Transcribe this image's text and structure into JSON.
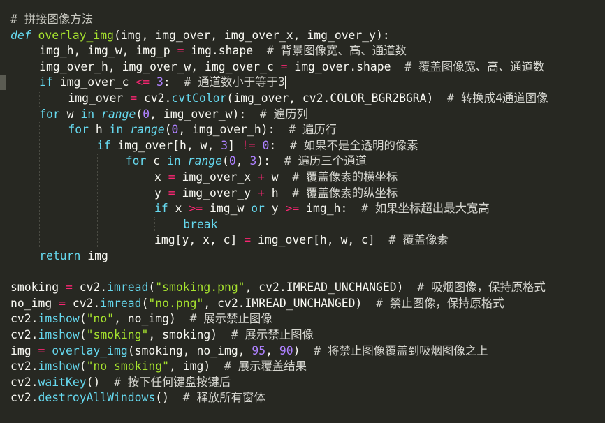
{
  "editor": {
    "lines": [
      {
        "indent": 0,
        "tokens": [
          {
            "t": "# 拼接图像方法",
            "c": "cm-head"
          }
        ]
      },
      {
        "indent": 0,
        "tokens": [
          {
            "t": "def",
            "c": "def"
          },
          {
            "t": " "
          },
          {
            "t": "overlay_img",
            "c": "fn"
          },
          {
            "t": "(img, img_over, img_over_x, img_over_y):"
          }
        ]
      },
      {
        "indent": 1,
        "tokens": [
          {
            "t": "img_h, img_w, img_p "
          },
          {
            "t": "=",
            "c": "op"
          },
          {
            "t": " img.shape  "
          },
          {
            "t": "# 背景图像宽、高、通道数",
            "c": "cm"
          }
        ]
      },
      {
        "indent": 1,
        "tokens": [
          {
            "t": "img_over_h, img_over_w, img_over_c "
          },
          {
            "t": "=",
            "c": "op"
          },
          {
            "t": " img_over.shape  "
          },
          {
            "t": "# 覆盖图像宽、高、通道数",
            "c": "cm"
          }
        ]
      },
      {
        "indent": 1,
        "marker": true,
        "tokens": [
          {
            "t": "if",
            "c": "kw"
          },
          {
            "t": " img_over_c "
          },
          {
            "t": "<=",
            "c": "op"
          },
          {
            "t": " "
          },
          {
            "t": "3",
            "c": "num"
          },
          {
            "t": ":  "
          },
          {
            "t": "# 通道数小于等于3",
            "c": "cm"
          },
          {
            "cursor": true
          }
        ]
      },
      {
        "indent": 2,
        "tokens": [
          {
            "t": "img_over "
          },
          {
            "t": "=",
            "c": "op"
          },
          {
            "t": " cv2."
          },
          {
            "t": "cvtColor",
            "c": "kw"
          },
          {
            "t": "(img_over, cv2.COLOR_BGR2BGRA)  "
          },
          {
            "t": "# 转换成4通道图像",
            "c": "cm"
          }
        ]
      },
      {
        "indent": 1,
        "tokens": [
          {
            "t": "for",
            "c": "kw"
          },
          {
            "t": " w "
          },
          {
            "t": "in",
            "c": "kw"
          },
          {
            "t": " "
          },
          {
            "t": "range",
            "c": "bi"
          },
          {
            "t": "("
          },
          {
            "t": "0",
            "c": "num"
          },
          {
            "t": ", img_over_w):  "
          },
          {
            "t": "# 遍历列",
            "c": "cm"
          }
        ]
      },
      {
        "indent": 2,
        "tokens": [
          {
            "t": "for",
            "c": "kw"
          },
          {
            "t": " h "
          },
          {
            "t": "in",
            "c": "kw"
          },
          {
            "t": " "
          },
          {
            "t": "range",
            "c": "bi"
          },
          {
            "t": "("
          },
          {
            "t": "0",
            "c": "num"
          },
          {
            "t": ", img_over_h):  "
          },
          {
            "t": "# 遍历行",
            "c": "cm"
          }
        ]
      },
      {
        "indent": 3,
        "tokens": [
          {
            "t": "if",
            "c": "kw"
          },
          {
            "t": " img_over[h, w, "
          },
          {
            "t": "3",
            "c": "num"
          },
          {
            "t": "] "
          },
          {
            "t": "!=",
            "c": "op"
          },
          {
            "t": " "
          },
          {
            "t": "0",
            "c": "num"
          },
          {
            "t": ":  "
          },
          {
            "t": "# 如果不是全透明的像素",
            "c": "cm"
          }
        ]
      },
      {
        "indent": 4,
        "tokens": [
          {
            "t": "for",
            "c": "kw"
          },
          {
            "t": " c "
          },
          {
            "t": "in",
            "c": "kw"
          },
          {
            "t": " "
          },
          {
            "t": "range",
            "c": "bi"
          },
          {
            "t": "("
          },
          {
            "t": "0",
            "c": "num"
          },
          {
            "t": ", "
          },
          {
            "t": "3",
            "c": "num"
          },
          {
            "t": "):  "
          },
          {
            "t": "# 遍历三个通道",
            "c": "cm"
          }
        ]
      },
      {
        "indent": 5,
        "tokens": [
          {
            "t": "x "
          },
          {
            "t": "=",
            "c": "op"
          },
          {
            "t": " img_over_x "
          },
          {
            "t": "+",
            "c": "op"
          },
          {
            "t": " w  "
          },
          {
            "t": "# 覆盖像素的横坐标",
            "c": "cm"
          }
        ]
      },
      {
        "indent": 5,
        "tokens": [
          {
            "t": "y "
          },
          {
            "t": "=",
            "c": "op"
          },
          {
            "t": " img_over_y "
          },
          {
            "t": "+",
            "c": "op"
          },
          {
            "t": " h  "
          },
          {
            "t": "# 覆盖像素的纵坐标",
            "c": "cm"
          }
        ]
      },
      {
        "indent": 5,
        "tokens": [
          {
            "t": "if",
            "c": "kw"
          },
          {
            "t": " x "
          },
          {
            "t": ">=",
            "c": "op"
          },
          {
            "t": " img_w "
          },
          {
            "t": "or",
            "c": "kw"
          },
          {
            "t": " y "
          },
          {
            "t": ">=",
            "c": "op"
          },
          {
            "t": " img_h:  "
          },
          {
            "t": "# 如果坐标超出最大宽高",
            "c": "cm"
          }
        ]
      },
      {
        "indent": 6,
        "tokens": [
          {
            "t": "break",
            "c": "kw"
          }
        ]
      },
      {
        "indent": 5,
        "tokens": [
          {
            "t": "img[y, x, c] "
          },
          {
            "t": "=",
            "c": "op"
          },
          {
            "t": " img_over[h, w, c]  "
          },
          {
            "t": "# 覆盖像素",
            "c": "cm"
          }
        ]
      },
      {
        "indent": 1,
        "tokens": [
          {
            "t": "return",
            "c": "kw"
          },
          {
            "t": " img"
          }
        ]
      },
      {
        "indent": 0,
        "tokens": []
      },
      {
        "indent": 0,
        "tokens": [
          {
            "t": "smoking "
          },
          {
            "t": "=",
            "c": "op"
          },
          {
            "t": " cv2."
          },
          {
            "t": "imread",
            "c": "kw"
          },
          {
            "t": "("
          },
          {
            "t": "\"smoking.png\"",
            "c": "str"
          },
          {
            "t": ", cv2.IMREAD_UNCHANGED)  "
          },
          {
            "t": "# 吸烟图像，保持原格式",
            "c": "cm"
          }
        ]
      },
      {
        "indent": 0,
        "tokens": [
          {
            "t": "no_img "
          },
          {
            "t": "=",
            "c": "op"
          },
          {
            "t": " cv2."
          },
          {
            "t": "imread",
            "c": "kw"
          },
          {
            "t": "("
          },
          {
            "t": "\"no.png\"",
            "c": "str"
          },
          {
            "t": ", cv2.IMREAD_UNCHANGED)  "
          },
          {
            "t": "# 禁止图像，保持原格式",
            "c": "cm"
          }
        ]
      },
      {
        "indent": 0,
        "tokens": [
          {
            "t": "cv2."
          },
          {
            "t": "imshow",
            "c": "kw"
          },
          {
            "t": "("
          },
          {
            "t": "\"no\"",
            "c": "str"
          },
          {
            "t": ", no_img)  "
          },
          {
            "t": "# 展示禁止图像",
            "c": "cm"
          }
        ]
      },
      {
        "indent": 0,
        "tokens": [
          {
            "t": "cv2."
          },
          {
            "t": "imshow",
            "c": "kw"
          },
          {
            "t": "("
          },
          {
            "t": "\"smoking\"",
            "c": "str"
          },
          {
            "t": ", smoking)  "
          },
          {
            "t": "# 展示禁止图像",
            "c": "cm"
          }
        ]
      },
      {
        "indent": 0,
        "tokens": [
          {
            "t": "img "
          },
          {
            "t": "=",
            "c": "op"
          },
          {
            "t": " "
          },
          {
            "t": "overlay_img",
            "c": "kw"
          },
          {
            "t": "(smoking, no_img, "
          },
          {
            "t": "95",
            "c": "num"
          },
          {
            "t": ", "
          },
          {
            "t": "90",
            "c": "num"
          },
          {
            "t": ")  "
          },
          {
            "t": "# 将禁止图像覆盖到吸烟图像之上",
            "c": "cm"
          }
        ]
      },
      {
        "indent": 0,
        "tokens": [
          {
            "t": "cv2."
          },
          {
            "t": "imshow",
            "c": "kw"
          },
          {
            "t": "("
          },
          {
            "t": "\"no smoking\"",
            "c": "str"
          },
          {
            "t": ", img)  "
          },
          {
            "t": "# 展示覆盖结果",
            "c": "cm"
          }
        ]
      },
      {
        "indent": 0,
        "tokens": [
          {
            "t": "cv2."
          },
          {
            "t": "waitKey",
            "c": "kw"
          },
          {
            "t": "()  "
          },
          {
            "t": "# 按下任何键盘按键后",
            "c": "cm"
          }
        ]
      },
      {
        "indent": 0,
        "tokens": [
          {
            "t": "cv2."
          },
          {
            "t": "destroyAllWindows",
            "c": "kw"
          },
          {
            "t": "()  "
          },
          {
            "t": "# 释放所有窗体",
            "c": "cm"
          }
        ]
      }
    ]
  }
}
